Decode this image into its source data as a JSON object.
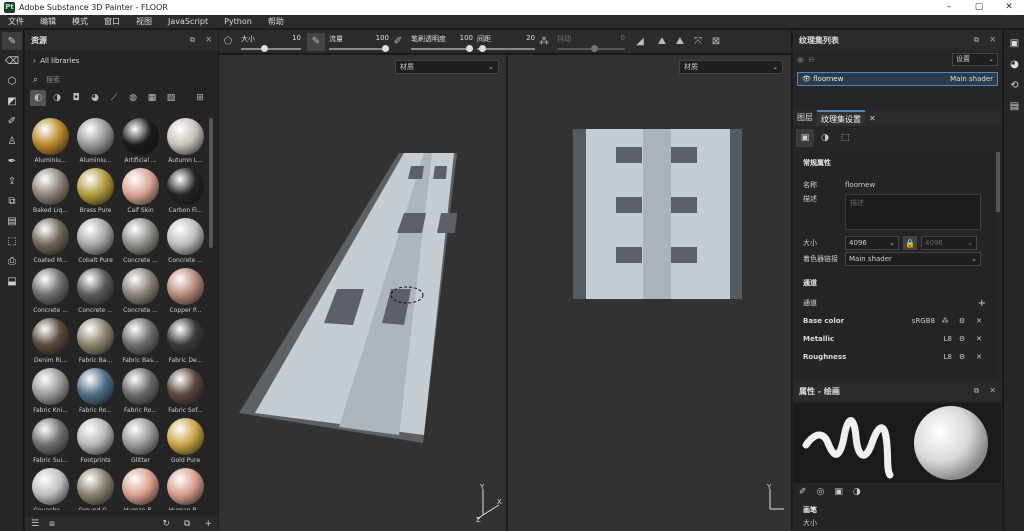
{
  "title": "Adobe Substance 3D Painter - FLOOR",
  "window_controls": [
    "–",
    "▢",
    "✕"
  ],
  "menu": [
    "文件",
    "编辑",
    "模式",
    "窗口",
    "视图",
    "JavaScript",
    "Python",
    "帮助"
  ],
  "assets": {
    "header": "资源",
    "library": "All libraries",
    "search_placeholder": "搜索",
    "items": [
      {
        "label": "Aluminiu...",
        "color": "#b9892b"
      },
      {
        "label": "Aluminiu...",
        "color": "#9a9a9a"
      },
      {
        "label": "Artificial ...",
        "color": "#1a1a1a"
      },
      {
        "label": "Autumn L...",
        "color": "#c7c2ba"
      },
      {
        "label": "Baked Liq...",
        "color": "#8e857a"
      },
      {
        "label": "Brass Pure",
        "color": "#b29a3c"
      },
      {
        "label": "Calf Skin",
        "color": "#d9a596"
      },
      {
        "label": "Carbon Fi...",
        "color": "#222222"
      },
      {
        "label": "Coated M...",
        "color": "#6e6757"
      },
      {
        "label": "Cobalt Pure",
        "color": "#a8a8a8"
      },
      {
        "label": "Concrete ...",
        "color": "#8f8f8a"
      },
      {
        "label": "Concrete ...",
        "color": "#bdbdbd"
      },
      {
        "label": "Concrete ...",
        "color": "#6e6e6e"
      },
      {
        "label": "Concrete ...",
        "color": "#5a5a5a"
      },
      {
        "label": "Concrete ...",
        "color": "#8a8277"
      },
      {
        "label": "Copper P...",
        "color": "#b88a7a"
      },
      {
        "label": "Denim Ri...",
        "color": "#5a4a3a"
      },
      {
        "label": "Fabric Ba...",
        "color": "#8b846e"
      },
      {
        "label": "Fabric Bas...",
        "color": "#6e6e6e"
      },
      {
        "label": "Fabric De...",
        "color": "#3a3a3a"
      },
      {
        "label": "Fabric Kni...",
        "color": "#9a9a9a"
      },
      {
        "label": "Fabric Ro...",
        "color": "#4d6d86"
      },
      {
        "label": "Fabric Ro...",
        "color": "#6a6a6a"
      },
      {
        "label": "Fabric Sof...",
        "color": "#5b463a"
      },
      {
        "label": "Fabric Sui...",
        "color": "#707070"
      },
      {
        "label": "Footprints",
        "color": "#b8b8b8"
      },
      {
        "label": "Glitter",
        "color": "#9a9a9a"
      },
      {
        "label": "Gold Pure",
        "color": "#c9a545"
      },
      {
        "label": "Gouache ...",
        "color": "#c0c0c0"
      },
      {
        "label": "Ground G...",
        "color": "#8a826e"
      },
      {
        "label": "Human B...",
        "color": "#dba08f"
      },
      {
        "label": "Human B...",
        "color": "#d89e8c"
      }
    ]
  },
  "toolbar": {
    "size_label": "大小",
    "size_value": "10",
    "flow_label": "流量",
    "flow_value": "100",
    "opacity_label": "笔刷透明度",
    "opacity_value": "100",
    "spacing_label": "间距",
    "spacing_value": "20",
    "angle_label": "抖动",
    "angle_value": "0"
  },
  "viewport3d": {
    "material_select": "材质"
  },
  "viewport2d": {
    "material_select": "材质"
  },
  "texture_set_list": {
    "header": "纹理集列表",
    "settings_select": "设置",
    "item_name": "floornew",
    "item_shader": "Main shader"
  },
  "tabs": {
    "layers": "图层",
    "texture_settings": "纹理集设置"
  },
  "texture_settings": {
    "general_title": "常规属性",
    "name_label": "名称",
    "name_value": "floornew",
    "desc_label": "描述",
    "desc_placeholder": "描述",
    "size_label": "大小",
    "size_value": "4096",
    "size_value2": "4096",
    "shader_label": "着色器链接",
    "shader_value": "Main shader",
    "channels_title": "通道",
    "channels_label": "通道",
    "channels": [
      {
        "name": "Base color",
        "format": "sRGB8"
      },
      {
        "name": "Metallic",
        "format": "L8"
      },
      {
        "name": "Roughness",
        "format": "L8"
      }
    ]
  },
  "properties": {
    "header": "属性 - 绘画",
    "section": "画笔",
    "size_label": "大小"
  }
}
